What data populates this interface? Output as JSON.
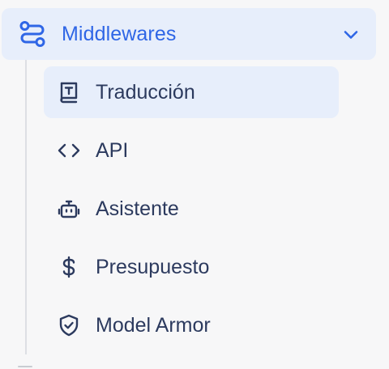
{
  "group": {
    "label": "Middlewares",
    "icon": "route-icon",
    "expanded": true
  },
  "items": [
    {
      "label": "Traducción",
      "icon": "translate-book-icon",
      "active": true
    },
    {
      "label": "API",
      "icon": "code-icon",
      "active": false
    },
    {
      "label": "Asistente",
      "icon": "bot-icon",
      "active": false
    },
    {
      "label": "Presupuesto",
      "icon": "dollar-icon",
      "active": false
    },
    {
      "label": "Model Armor",
      "icon": "shield-check-icon",
      "active": false
    }
  ],
  "colors": {
    "accent": "#2f66e6",
    "active_bg": "#e7eefb",
    "text": "#2c3a5e",
    "background": "#f7f7f8"
  }
}
